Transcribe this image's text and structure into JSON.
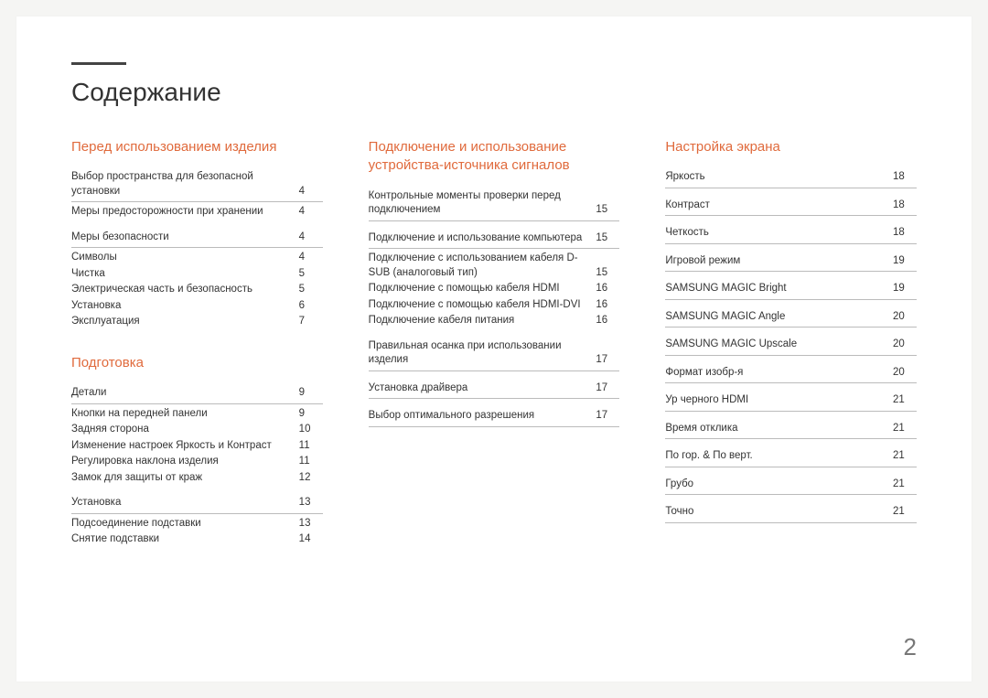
{
  "title": "Содержание",
  "page_number": "2",
  "columns": [
    {
      "sections": [
        {
          "title": "Перед использованием изделия",
          "groups": [
            {
              "head": {
                "label": "Выбор пространства для безопасной установки",
                "page": "4"
              },
              "subs": [
                {
                  "label": "Меры предосторожности при хранении",
                  "page": "4"
                }
              ]
            },
            {
              "head": {
                "label": "Меры безопасности",
                "page": "4"
              },
              "subs": [
                {
                  "label": "Символы",
                  "page": "4"
                },
                {
                  "label": "Чистка",
                  "page": "5"
                },
                {
                  "label": "Электрическая часть и безопасность",
                  "page": "5"
                },
                {
                  "label": "Установка",
                  "page": "6"
                },
                {
                  "label": "Эксплуатация",
                  "page": "7"
                }
              ]
            }
          ]
        },
        {
          "title": "Подготовка",
          "groups": [
            {
              "head": {
                "label": "Детали",
                "page": "9"
              },
              "subs": [
                {
                  "label": "Кнопки на передней панели",
                  "page": "9"
                },
                {
                  "label": "Задняя сторона",
                  "page": "10"
                },
                {
                  "label": "Изменение настроек Яркость и Контраст",
                  "page": "11"
                },
                {
                  "label": "Регулировка наклона изделия",
                  "page": "11"
                },
                {
                  "label": "Замок для защиты от краж",
                  "page": "12"
                }
              ]
            },
            {
              "head": {
                "label": "Установка",
                "page": "13"
              },
              "subs": [
                {
                  "label": "Подсоединение подставки",
                  "page": "13"
                },
                {
                  "label": "Снятие подставки",
                  "page": "14"
                }
              ]
            }
          ]
        }
      ]
    },
    {
      "sections": [
        {
          "title": "Подключение и использование устройства-источника сигналов",
          "groups": [
            {
              "head": {
                "label": "Контрольные моменты проверки перед подключением",
                "page": "15"
              },
              "subs": []
            },
            {
              "head": {
                "label": "Подключение и использование компьютера",
                "page": "15"
              },
              "subs": [
                {
                  "label": "Подключение с использованием кабеля D-SUB (аналоговый тип)",
                  "page": "15"
                },
                {
                  "label": "Подключение с помощью кабеля HDMI",
                  "page": "16"
                },
                {
                  "label": "Подключение с помощью кабеля HDMI-DVI",
                  "page": "16"
                },
                {
                  "label": "Подключение кабеля питания",
                  "page": "16"
                }
              ]
            },
            {
              "head": {
                "label": "Правильная осанка при использовании изделия",
                "page": "17"
              },
              "subs": []
            },
            {
              "head": {
                "label": "Установка драйвера",
                "page": "17"
              },
              "subs": []
            },
            {
              "head": {
                "label": "Выбор оптимального разрешения",
                "page": "17"
              },
              "subs": []
            }
          ]
        }
      ]
    },
    {
      "sections": [
        {
          "title": "Настройка экрана",
          "groups": [
            {
              "head": {
                "label": "Яркость",
                "page": "18"
              },
              "subs": []
            },
            {
              "head": {
                "label": "Контраст",
                "page": "18"
              },
              "subs": []
            },
            {
              "head": {
                "label": "Четкость",
                "page": "18"
              },
              "subs": []
            },
            {
              "head": {
                "label": "Игровой режим",
                "page": "19"
              },
              "subs": []
            },
            {
              "head": {
                "label": "SAMSUNG MAGIC Bright",
                "page": "19"
              },
              "subs": []
            },
            {
              "head": {
                "label": "SAMSUNG MAGIC Angle",
                "page": "20"
              },
              "subs": []
            },
            {
              "head": {
                "label": "SAMSUNG MAGIC Upscale",
                "page": "20"
              },
              "subs": []
            },
            {
              "head": {
                "label": "Формат изобр-я",
                "page": "20"
              },
              "subs": []
            },
            {
              "head": {
                "label": "Ур черного HDMI",
                "page": "21"
              },
              "subs": []
            },
            {
              "head": {
                "label": "Время отклика",
                "page": "21"
              },
              "subs": []
            },
            {
              "head": {
                "label": "По гор. & По верт.",
                "page": "21"
              },
              "subs": []
            },
            {
              "head": {
                "label": "Грубо",
                "page": "21"
              },
              "subs": []
            },
            {
              "head": {
                "label": "Точно",
                "page": "21"
              },
              "subs": []
            }
          ]
        }
      ]
    }
  ]
}
